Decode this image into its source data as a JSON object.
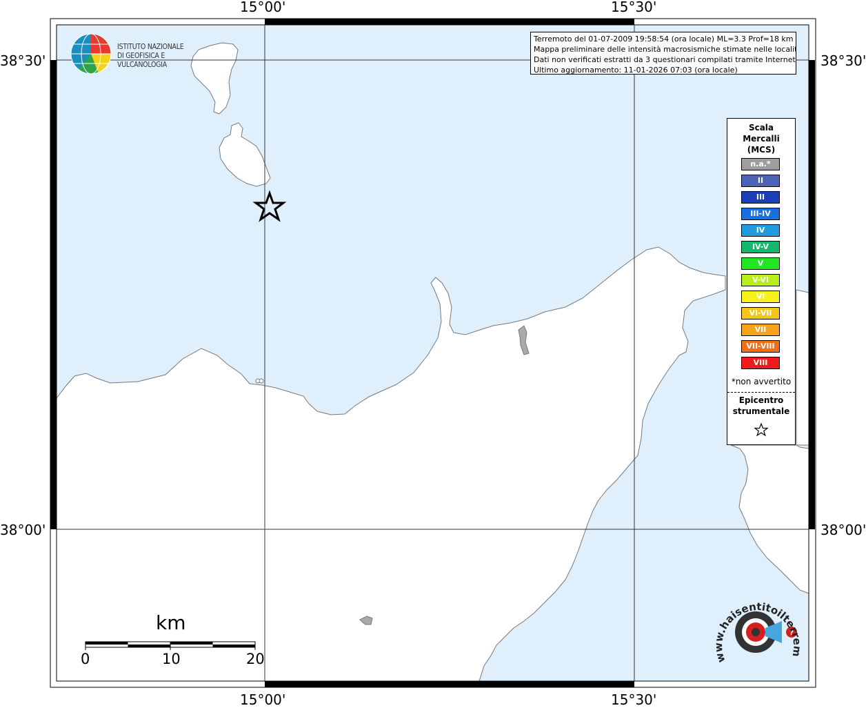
{
  "info": {
    "line1": "Terremoto del 01-07-2009 19:58:54 (ora locale) ML=3.3 Prof=18 km",
    "line2": "Mappa preliminare delle intensità macrosismiche stimate nelle località",
    "line3": "Dati non verificati estratti da 3 questionari compilati tramite Internet.",
    "line4": "Ultimo aggiornamento: 11-01-2026 07:03 (ora locale)"
  },
  "coords": {
    "top_left": "15°00'",
    "top_right": "15°30'",
    "bottom_left": "15°00'",
    "bottom_right": "15°30'",
    "left_top": "38°30'",
    "left_bottom": "38°00'",
    "right_top": "38°30'",
    "right_bottom": "38°00'"
  },
  "logo": {
    "line1": "ISTITUTO NAZIONALE",
    "line2": "DI GEOFISICA E VULCANOLOGIA"
  },
  "legend": {
    "title1": "Scala",
    "title2": "Mercalli",
    "title3": "(MCS)",
    "items": [
      {
        "label": "n.a.*",
        "color": "#9e9e9e"
      },
      {
        "label": "II",
        "color": "#4a63b5"
      },
      {
        "label": "III",
        "color": "#1a3fb8"
      },
      {
        "label": "III-IV",
        "color": "#1670e0"
      },
      {
        "label": "IV",
        "color": "#1f9be0"
      },
      {
        "label": "IV-V",
        "color": "#14b86a"
      },
      {
        "label": "V",
        "color": "#22e622"
      },
      {
        "label": "V-VI",
        "color": "#b6ef1a"
      },
      {
        "label": "VI",
        "color": "#f6f21a"
      },
      {
        "label": "VI-VII",
        "color": "#f6c51a"
      },
      {
        "label": "VII",
        "color": "#f6a31a"
      },
      {
        "label": "VII-VIII",
        "color": "#f0701a"
      },
      {
        "label": "VIII",
        "color": "#f01a1a"
      }
    ],
    "note": "*non avvertito",
    "epi1": "Epicentro",
    "epi2": "strumentale"
  },
  "scale": {
    "unit": "km",
    "ticks": [
      "0",
      "10",
      "20"
    ]
  },
  "colors": {
    "sea": "#dff0fc",
    "land": "#ffffff",
    "coast": "#777777"
  },
  "hse_logo": {
    "text": "www.haisentitoilterremoto.it"
  }
}
